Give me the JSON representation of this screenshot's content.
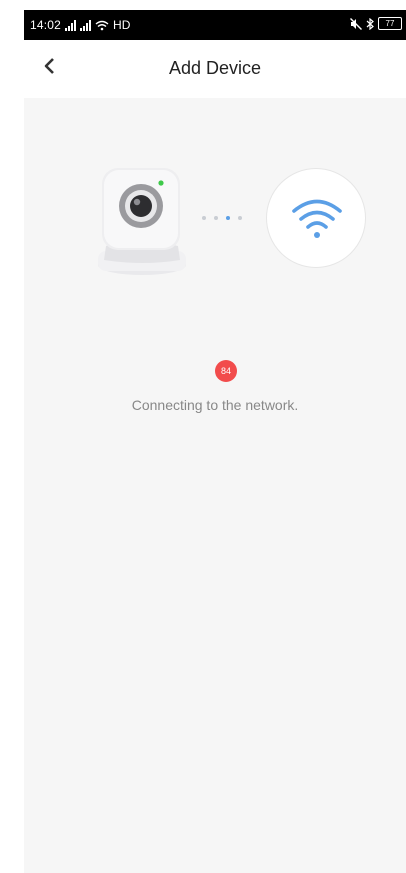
{
  "status_bar": {
    "time": "14:02",
    "network": "HD",
    "battery": "77"
  },
  "header": {
    "title": "Add Device"
  },
  "pairing": {
    "progress_value": "84",
    "progress_percent": 84,
    "status_message": "Connecting to the network."
  },
  "colors": {
    "badge": "#f24c4c",
    "wifi_icon": "#5b9fe6",
    "active_dot": "#5b9fe6",
    "camera_led": "#3ec94a",
    "background": "#f6f6f6"
  }
}
